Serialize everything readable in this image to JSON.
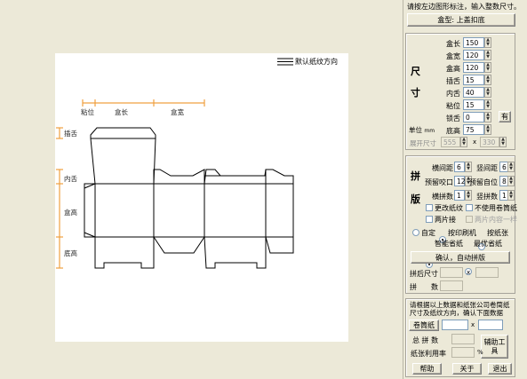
{
  "hint": "请按左边图形标注，输入整数尺寸。",
  "box_type_button": "盒型: 上盖扣底",
  "diagram": {
    "legend": "默认纸纹方向",
    "dim_labels": {
      "zhanwei": "粘位",
      "hechang": "盒长",
      "hekuan": "盒宽"
    },
    "side_labels": {
      "chashe": "插舌",
      "neishe": "内舌",
      "hegao": "盒高",
      "digao": "底高"
    }
  },
  "size": {
    "title_top": "尺",
    "title_bottom": "寸",
    "fields": [
      {
        "label": "盒长",
        "value": "150"
      },
      {
        "label": "盒宽",
        "value": "120"
      },
      {
        "label": "盒高",
        "value": "120"
      },
      {
        "label": "插舌",
        "value": "15"
      },
      {
        "label": "内舌",
        "value": "40"
      },
      {
        "label": "粘位",
        "value": "15"
      },
      {
        "label": "锁舌",
        "value": "0"
      },
      {
        "label": "底高",
        "value": "75"
      }
    ],
    "lock_button": "有",
    "unit_label": "单位",
    "unit": "mm",
    "unfold_label": "展开尺寸",
    "unfold_w": "555",
    "unfold_x": "x",
    "unfold_h": "330"
  },
  "layout": {
    "title_top": "拼",
    "title_bottom": "版",
    "rows": [
      {
        "label_a": "横间距",
        "value_a": "6",
        "label_b": "竖间距",
        "value_b": "6"
      },
      {
        "label_a": "预留咬口",
        "value_a": "12",
        "label_b": "预留自位",
        "value_b": "8"
      },
      {
        "label_a": "横拼数",
        "value_a": "1",
        "label_b": "竖拼数",
        "value_b": "1"
      }
    ],
    "checks": [
      {
        "label": "更改纸纹",
        "disabled": false
      },
      {
        "label": "不使用卷筒纸",
        "disabled": false
      },
      {
        "label": "两片接",
        "disabled": false
      },
      {
        "label": "两片内容一样",
        "disabled": true
      }
    ],
    "radios_row1": [
      {
        "label": "自定",
        "on": false
      },
      {
        "label": "按印刷机",
        "on": true
      },
      {
        "label": "按纸张",
        "on": false
      }
    ],
    "radios_row2": [
      {
        "label": "智能省纸",
        "on": true
      },
      {
        "label": "最优省纸",
        "on": false
      }
    ],
    "confirm_button": "确认，自动拼版",
    "after_size_label": "拼后尺寸",
    "after_size_x": "x",
    "count_label": "拼　　数"
  },
  "roll": {
    "info": "请根据以上数据和纸张公司卷筒纸尺寸及纸纹方向，确认下面数据",
    "roll_button": "卷筒纸",
    "roll_x": "x",
    "total_label": "总 拼 数",
    "util_label": "纸张利用率",
    "percent": "%",
    "aux_button": "辅助工具",
    "help": "帮助",
    "about": "关于",
    "exit": "退出"
  },
  "colors": {
    "dim_line": "#f0a040",
    "die_line": "#000000",
    "canvas": "#ffffff"
  }
}
